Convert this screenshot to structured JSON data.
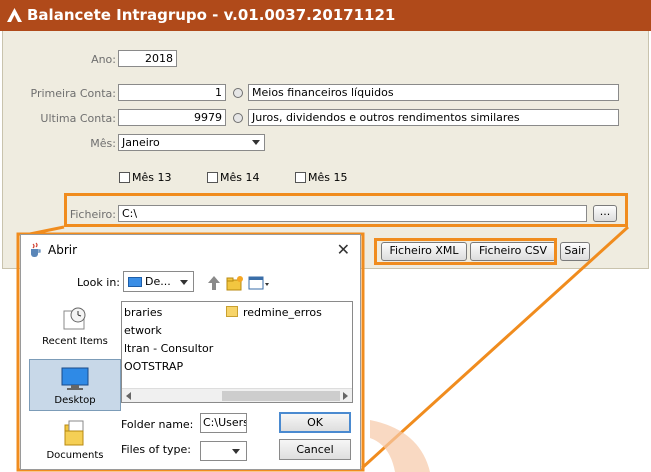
{
  "window": {
    "title": "Balancete Intragrupo - v.01.0037.20171121"
  },
  "form": {
    "ano_label": "Ano:",
    "ano_value": "2018",
    "primeira_label": "Primeira Conta:",
    "primeira_value": "1",
    "primeira_desc": "Meios financeiros líquidos",
    "ultima_label": "Ultima Conta:",
    "ultima_value": "9979",
    "ultima_desc": "Juros, dividendos e outros rendimentos similares",
    "mes_label": "Mês:",
    "mes_value": "Janeiro",
    "mes13": "Mês 13",
    "mes14": "Mês 14",
    "mes15": "Mês 15",
    "ficheiro_label": "Ficheiro:",
    "ficheiro_value": "C:\\",
    "browse_label": "...",
    "btn_xml": "Ficheiro XML",
    "btn_csv": "Ficheiro CSV",
    "btn_sair": "Sair"
  },
  "dialog": {
    "title": "Abrir",
    "close_glyph": "✕",
    "lookin_label": "Look in:",
    "lookin_value": "De...",
    "places": [
      "Recent Items",
      "Desktop",
      "Documents"
    ],
    "files": [
      "braries",
      "etwork",
      "ltran - Consultor",
      "OOTSTRAP",
      "redmine_erros"
    ],
    "folder_name_label": "Folder name:",
    "folder_name_value": "C:\\Users",
    "files_of_type_label": "Files of type:",
    "ok_label": "OK",
    "cancel_label": "Cancel"
  },
  "colors": {
    "title_bar": "#b04a1a",
    "panel_bg": "#efece0",
    "highlight": "#f08c1e"
  }
}
